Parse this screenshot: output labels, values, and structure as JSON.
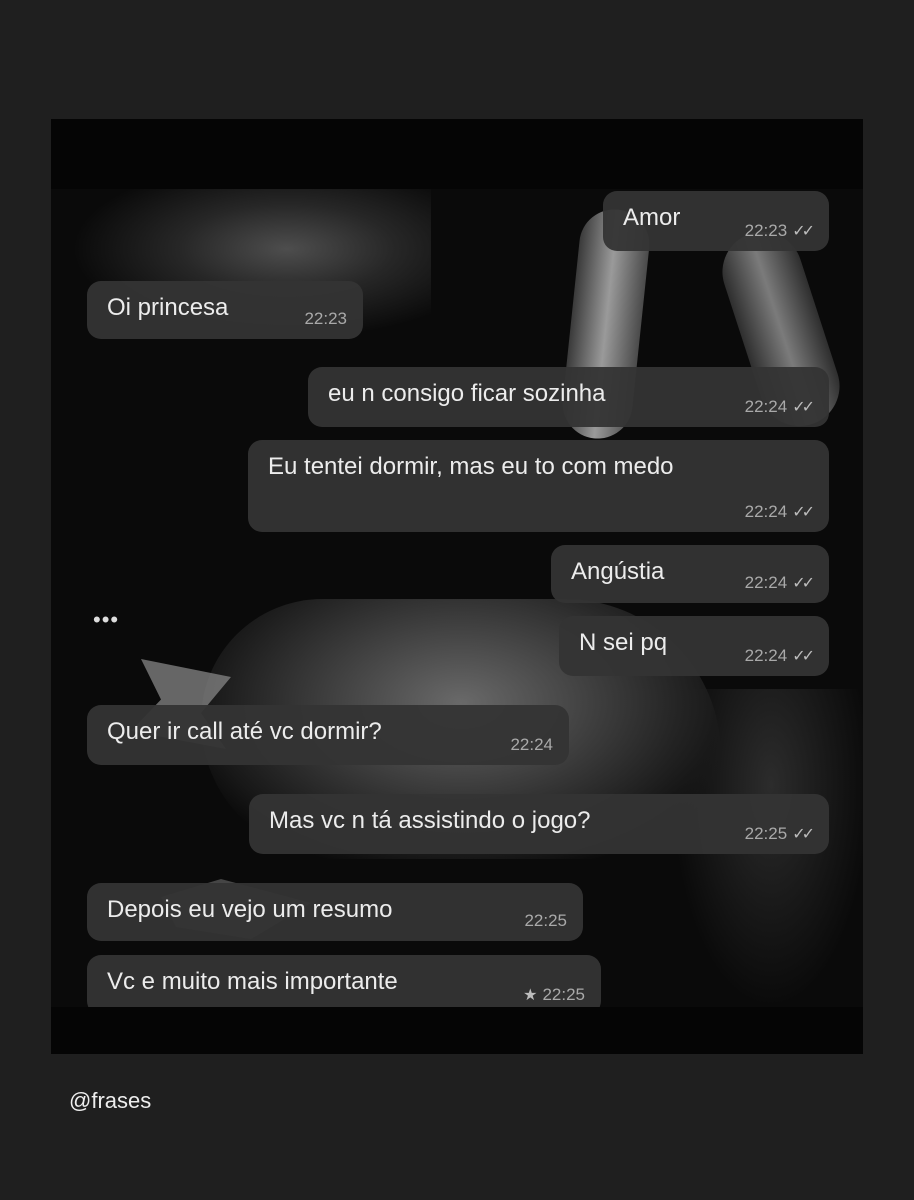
{
  "messages": [
    {
      "text": "Amor",
      "time": "22:23",
      "status": "read",
      "direction": "out"
    },
    {
      "text": "Oi princesa",
      "time": "22:23",
      "direction": "in"
    },
    {
      "text": "eu n consigo ficar sozinha",
      "time": "22:24",
      "status": "read",
      "direction": "out"
    },
    {
      "text": "Eu tentei dormir, mas eu to com medo",
      "time": "22:24",
      "status": "read",
      "direction": "out"
    },
    {
      "text": "Angústia",
      "time": "22:24",
      "status": "read",
      "direction": "out"
    },
    {
      "text": "N sei pq",
      "time": "22:24",
      "status": "read",
      "direction": "out"
    },
    {
      "text": "Quer ir call até vc dormir?",
      "time": "22:24",
      "direction": "in"
    },
    {
      "text": "Mas vc n tá assistindo o jogo?",
      "time": "22:25",
      "status": "read",
      "direction": "out"
    },
    {
      "text": "Depois eu vejo um resumo",
      "time": "22:25",
      "direction": "in"
    },
    {
      "text": "Vc e muito mais importante",
      "time": "22:25",
      "starred": true,
      "direction": "in"
    }
  ],
  "typing_indicator": "•••",
  "read_ticks": "✓✓",
  "star_glyph": "★",
  "watermark": "@frases",
  "colors": {
    "background": "#1f1f1f",
    "bubble": "#343434",
    "text": "#ececec",
    "meta": "#a9a9a9"
  }
}
